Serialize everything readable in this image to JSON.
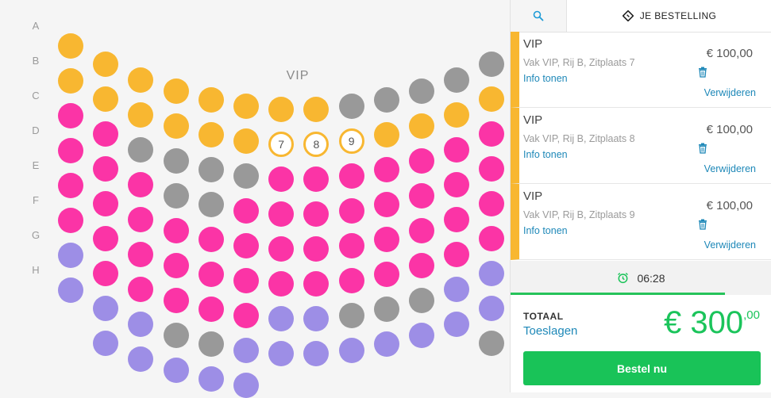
{
  "colors": {
    "category_orange": "#f8b731",
    "category_pink": "#fb34a6",
    "category_grey": "#999999",
    "category_purple": "#9d8ee6",
    "link": "#1e88b8",
    "accent_green": "#19c358"
  },
  "seatmap": {
    "section_label": "VIP",
    "row_labels": [
      "A",
      "B",
      "C",
      "D",
      "E",
      "F",
      "G",
      "H"
    ],
    "columns": [
      [
        "o",
        "o",
        "p",
        "p",
        "p",
        "p",
        "u",
        "u"
      ],
      [
        "o",
        "o",
        "p",
        "p",
        "p",
        "p",
        "p",
        "u",
        "u"
      ],
      [
        "o",
        "o",
        "g",
        "p",
        "p",
        "p",
        "p",
        "u",
        "u"
      ],
      [
        "o",
        "o",
        "g",
        "g",
        "p",
        "p",
        "p",
        "g",
        "u"
      ],
      [
        "o",
        "o",
        "g",
        "g",
        "p",
        "p",
        "p",
        "g",
        "u"
      ],
      [
        "o",
        "o",
        "g",
        "p",
        "p",
        "p",
        "p",
        "u",
        "u"
      ],
      [
        "o",
        "s7",
        "p",
        "p",
        "p",
        "p",
        "u",
        "u"
      ],
      [
        "o",
        "s8",
        "p",
        "p",
        "p",
        "p",
        "u",
        "u"
      ],
      [
        "g",
        "s9",
        "p",
        "p",
        "p",
        "p",
        "g",
        "u"
      ],
      [
        "g",
        "o",
        "p",
        "p",
        "p",
        "p",
        "g",
        "u"
      ],
      [
        "g",
        "o",
        "p",
        "p",
        "p",
        "p",
        "g",
        "u"
      ],
      [
        "g",
        "o",
        "p",
        "p",
        "p",
        "p",
        "u",
        "u"
      ],
      [
        "g",
        "o",
        "p",
        "p",
        "p",
        "p",
        "u",
        "u",
        "g"
      ]
    ]
  },
  "tabs": {
    "search_icon": "search-icon",
    "order_icon": "ticket-icon",
    "order_label": "JE BESTELLING"
  },
  "items": [
    {
      "title": "VIP",
      "subtitle": "Vak VIP, Rij B, Zitplaats 7",
      "info": "Info tonen",
      "price": "€ 100,00",
      "remove": "Verwijderen"
    },
    {
      "title": "VIP",
      "subtitle": "Vak VIP, Rij B, Zitplaats 8",
      "info": "Info tonen",
      "price": "€ 100,00",
      "remove": "Verwijderen"
    },
    {
      "title": "VIP",
      "subtitle": "Vak VIP, Rij B, Zitplaats 9",
      "info": "Info tonen",
      "price": "€ 100,00",
      "remove": "Verwijderen"
    }
  ],
  "timer": {
    "icon": "alarm-clock-icon",
    "time": "06:28",
    "remaining_fraction": 0.82
  },
  "total": {
    "label": "TOTAAL",
    "surcharges_link": "Toeslagen",
    "amount_main": "€ 300",
    "amount_cents": ",00"
  },
  "order_button": "Bestel nu"
}
